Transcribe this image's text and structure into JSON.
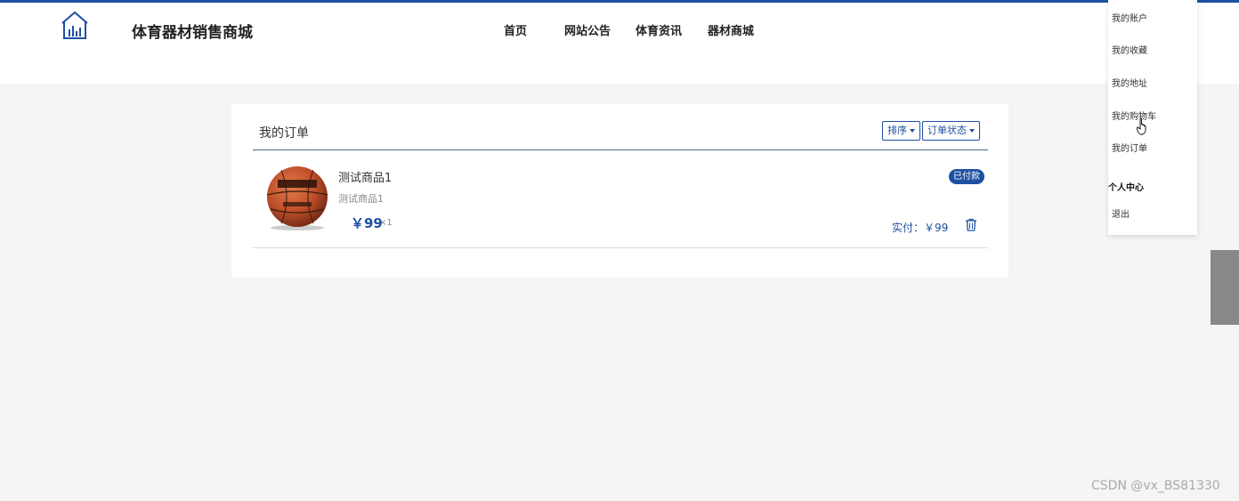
{
  "header": {
    "site_title": "体育器材销售商城",
    "nav": [
      "首页",
      "网站公告",
      "体育资讯",
      "器材商城"
    ]
  },
  "orders": {
    "title": "我的订单",
    "sort_label": "排序",
    "status_filter_label": "订单状态",
    "items": [
      {
        "name": "测试商品1",
        "subtitle": "测试商品1",
        "price": "￥99",
        "quantity": "×1",
        "status": "已付款",
        "paid_total": "实付：￥99"
      }
    ]
  },
  "user_menu": {
    "items": [
      "我的账户",
      "我的收藏",
      "我的地址",
      "我的购物车",
      "我的订单"
    ],
    "heading": "个人中心",
    "logout": "退出"
  },
  "watermark": "CSDN @vx_BS81330",
  "colors": {
    "accent": "#1e50a2",
    "page_bg": "#f5f5f5"
  }
}
